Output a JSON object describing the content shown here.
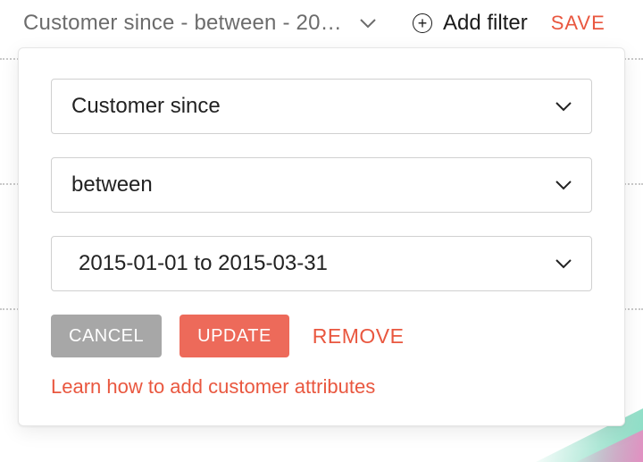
{
  "topbar": {
    "chip_label": "Customer since - between - 20…",
    "add_filter_label": "Add filter",
    "save_label": "SAVE"
  },
  "panel": {
    "fields": {
      "attribute": {
        "value": "Customer since"
      },
      "operator": {
        "value": "between"
      },
      "range": {
        "value": "2015-01-01 to 2015-03-31"
      }
    },
    "actions": {
      "cancel_label": "CANCEL",
      "update_label": "UPDATE",
      "remove_label": "REMOVE"
    },
    "help_link": "Learn how to add customer attributes"
  },
  "colors": {
    "accent": "#e9573f",
    "muted": "#6c6c6c",
    "border": "#d0d0d0",
    "button_gray": "#a7a7a7",
    "button_red": "#ed6a5a"
  }
}
